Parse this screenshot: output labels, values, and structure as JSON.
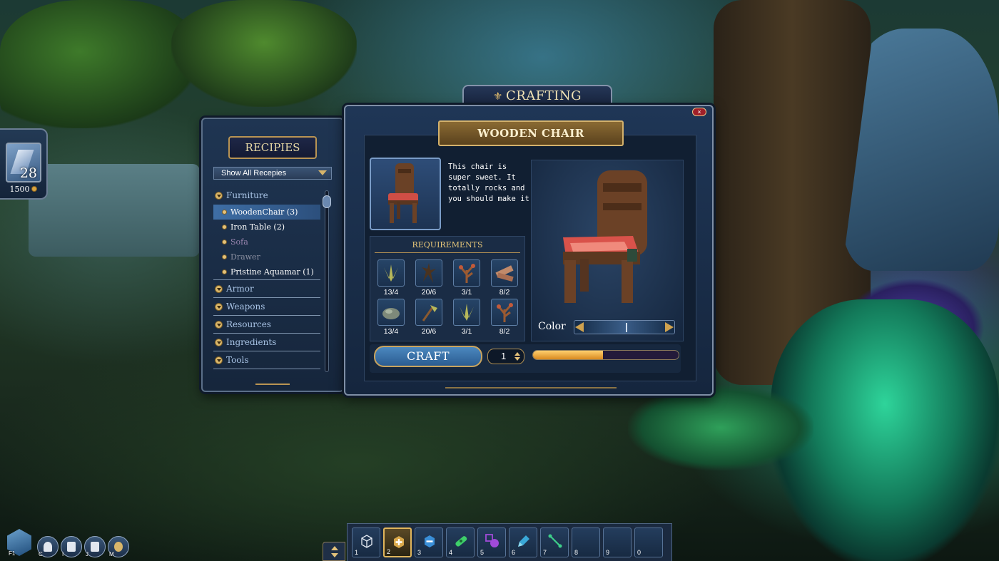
{
  "player": {
    "level": "28",
    "gold": "1500"
  },
  "recipes_panel": {
    "title": "RECIPIES",
    "filter": "Show All Recepies",
    "categories": [
      {
        "label": "Furniture",
        "items": [
          {
            "label": "WoodenChair (3)",
            "state": "selected"
          },
          {
            "label": "Iron Table (2)",
            "state": "available"
          },
          {
            "label": "Sofa",
            "state": "locked"
          },
          {
            "label": "Drawer",
            "state": "locked"
          },
          {
            "label": "Pristine Aquamar (1)",
            "state": "available"
          }
        ]
      },
      {
        "label": "Armor"
      },
      {
        "label": "Weapons"
      },
      {
        "label": "Resources"
      },
      {
        "label": "Ingredients"
      },
      {
        "label": "Tools"
      }
    ]
  },
  "crafting": {
    "title": "CRAFTING",
    "close_label": "×",
    "item_name": "WOODEN CHAIR",
    "description": "This chair is super sweet. It totally rocks and you should make it",
    "requirements_title": "REQUIREMENTS",
    "requirements": [
      {
        "icon": "grass-bundle-icon",
        "count": "13/4"
      },
      {
        "icon": "root-icon",
        "count": "20/6"
      },
      {
        "icon": "branch-icon",
        "count": "3/1"
      },
      {
        "icon": "wood-plank-icon",
        "count": "8/2"
      },
      {
        "icon": "stone-icon",
        "count": "13/4"
      },
      {
        "icon": "axe-icon",
        "count": "20/6"
      },
      {
        "icon": "grass-bundle-icon",
        "count": "3/1"
      },
      {
        "icon": "branch-icon",
        "count": "8/2"
      }
    ],
    "color_label": "Color",
    "craft_label": "CRAFT",
    "quantity": "1",
    "progress": 0.48
  },
  "hotbar": {
    "active_slot": 2,
    "slots": [
      {
        "num": "1",
        "icon": "wireframe-cube-icon"
      },
      {
        "num": "2",
        "icon": "add-cube-icon"
      },
      {
        "num": "3",
        "icon": "remove-cube-icon"
      },
      {
        "num": "4",
        "icon": "bandage-icon"
      },
      {
        "num": "5",
        "icon": "shapes-icon"
      },
      {
        "num": "6",
        "icon": "paint-brush-icon"
      },
      {
        "num": "7",
        "icon": "line-tool-icon"
      },
      {
        "num": "8",
        "icon": ""
      },
      {
        "num": "9",
        "icon": ""
      },
      {
        "num": "0",
        "icon": ""
      }
    ]
  },
  "bottom_menu": {
    "keys": [
      "F1",
      "C",
      "I",
      "J",
      "M"
    ]
  }
}
